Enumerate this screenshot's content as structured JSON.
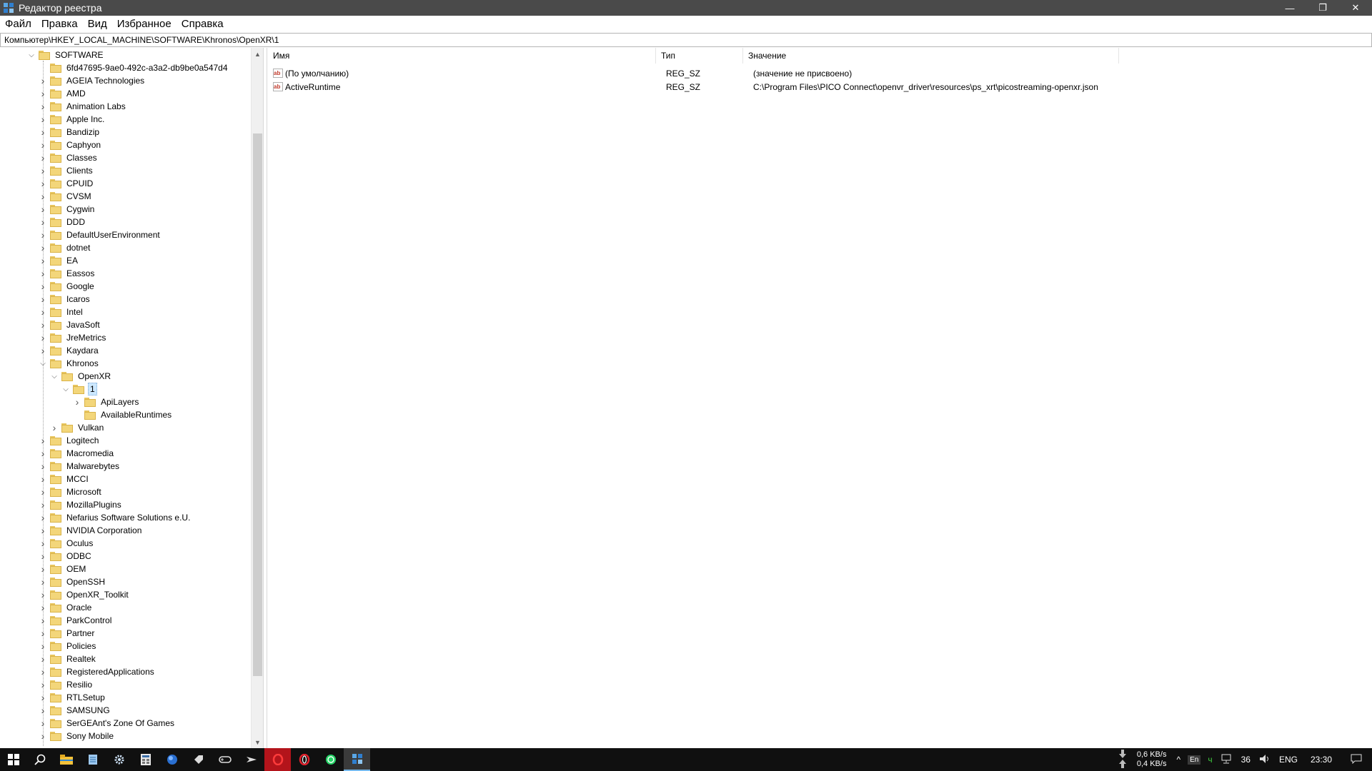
{
  "window": {
    "title": "Редактор реестра",
    "minimize_glyph": "—",
    "maximize_glyph": "❐",
    "close_glyph": "✕"
  },
  "menu": {
    "items": [
      "Файл",
      "Правка",
      "Вид",
      "Избранное",
      "Справка"
    ]
  },
  "address": {
    "path": "Компьютер\\HKEY_LOCAL_MACHINE\\SOFTWARE\\Khronos\\OpenXR\\1"
  },
  "tree": {
    "rows": [
      {
        "label": "SOFTWARE",
        "depth": 0,
        "expander": "expanded"
      },
      {
        "label": "6fd47695-9ae0-492c-a3a2-db9be0a547d4",
        "depth": 1,
        "expander": "none"
      },
      {
        "label": "AGEIA Technologies",
        "depth": 1,
        "expander": "collapsed"
      },
      {
        "label": "AMD",
        "depth": 1,
        "expander": "collapsed"
      },
      {
        "label": "Animation Labs",
        "depth": 1,
        "expander": "collapsed"
      },
      {
        "label": "Apple Inc.",
        "depth": 1,
        "expander": "collapsed"
      },
      {
        "label": "Bandizip",
        "depth": 1,
        "expander": "collapsed"
      },
      {
        "label": "Caphyon",
        "depth": 1,
        "expander": "collapsed"
      },
      {
        "label": "Classes",
        "depth": 1,
        "expander": "collapsed"
      },
      {
        "label": "Clients",
        "depth": 1,
        "expander": "collapsed"
      },
      {
        "label": "CPUID",
        "depth": 1,
        "expander": "collapsed"
      },
      {
        "label": "CVSM",
        "depth": 1,
        "expander": "collapsed"
      },
      {
        "label": "Cygwin",
        "depth": 1,
        "expander": "collapsed"
      },
      {
        "label": "DDD",
        "depth": 1,
        "expander": "collapsed"
      },
      {
        "label": "DefaultUserEnvironment",
        "depth": 1,
        "expander": "collapsed"
      },
      {
        "label": "dotnet",
        "depth": 1,
        "expander": "collapsed"
      },
      {
        "label": "EA",
        "depth": 1,
        "expander": "collapsed"
      },
      {
        "label": "Eassos",
        "depth": 1,
        "expander": "collapsed"
      },
      {
        "label": "Google",
        "depth": 1,
        "expander": "collapsed"
      },
      {
        "label": "Icaros",
        "depth": 1,
        "expander": "collapsed"
      },
      {
        "label": "Intel",
        "depth": 1,
        "expander": "collapsed"
      },
      {
        "label": "JavaSoft",
        "depth": 1,
        "expander": "collapsed"
      },
      {
        "label": "JreMetrics",
        "depth": 1,
        "expander": "collapsed"
      },
      {
        "label": "Kaydara",
        "depth": 1,
        "expander": "collapsed"
      },
      {
        "label": "Khronos",
        "depth": 1,
        "expander": "expanded"
      },
      {
        "label": "OpenXR",
        "depth": 2,
        "expander": "expanded"
      },
      {
        "label": "1",
        "depth": 3,
        "expander": "expanded",
        "selected": true
      },
      {
        "label": "ApiLayers",
        "depth": 4,
        "expander": "collapsed"
      },
      {
        "label": "AvailableRuntimes",
        "depth": 4,
        "expander": "none"
      },
      {
        "label": "Vulkan",
        "depth": 2,
        "expander": "collapsed"
      },
      {
        "label": "Logitech",
        "depth": 1,
        "expander": "collapsed"
      },
      {
        "label": "Macromedia",
        "depth": 1,
        "expander": "collapsed"
      },
      {
        "label": "Malwarebytes",
        "depth": 1,
        "expander": "collapsed"
      },
      {
        "label": "MCCI",
        "depth": 1,
        "expander": "collapsed"
      },
      {
        "label": "Microsoft",
        "depth": 1,
        "expander": "collapsed"
      },
      {
        "label": "MozillaPlugins",
        "depth": 1,
        "expander": "collapsed"
      },
      {
        "label": "Nefarius Software Solutions e.U.",
        "depth": 1,
        "expander": "collapsed"
      },
      {
        "label": "NVIDIA Corporation",
        "depth": 1,
        "expander": "collapsed"
      },
      {
        "label": "Oculus",
        "depth": 1,
        "expander": "collapsed"
      },
      {
        "label": "ODBC",
        "depth": 1,
        "expander": "collapsed"
      },
      {
        "label": "OEM",
        "depth": 1,
        "expander": "collapsed"
      },
      {
        "label": "OpenSSH",
        "depth": 1,
        "expander": "collapsed"
      },
      {
        "label": "OpenXR_Toolkit",
        "depth": 1,
        "expander": "collapsed"
      },
      {
        "label": "Oracle",
        "depth": 1,
        "expander": "collapsed"
      },
      {
        "label": "ParkControl",
        "depth": 1,
        "expander": "collapsed"
      },
      {
        "label": "Partner",
        "depth": 1,
        "expander": "collapsed"
      },
      {
        "label": "Policies",
        "depth": 1,
        "expander": "collapsed"
      },
      {
        "label": "Realtek",
        "depth": 1,
        "expander": "collapsed"
      },
      {
        "label": "RegisteredApplications",
        "depth": 1,
        "expander": "collapsed"
      },
      {
        "label": "Resilio",
        "depth": 1,
        "expander": "collapsed"
      },
      {
        "label": "RTLSetup",
        "depth": 1,
        "expander": "collapsed"
      },
      {
        "label": "SAMSUNG",
        "depth": 1,
        "expander": "collapsed"
      },
      {
        "label": "SerGEAnt's Zone Of Games",
        "depth": 1,
        "expander": "collapsed"
      },
      {
        "label": "Sony Mobile",
        "depth": 1,
        "expander": "collapsed"
      }
    ]
  },
  "values": {
    "columns": {
      "name": "Имя",
      "type": "Тип",
      "data": "Значение"
    },
    "rows": [
      {
        "name": "(По умолчанию)",
        "type": "REG_SZ",
        "data": "(значение не присвоено)"
      },
      {
        "name": "ActiveRuntime",
        "type": "REG_SZ",
        "data": "C:\\Program Files\\PICO Connect\\openvr_driver\\resources\\ps_xrt\\picostreaming-openxr.json"
      }
    ],
    "icon_text": "ab"
  },
  "taskbar": {
    "speed_down": "0,6 KB/s",
    "speed_up": "0,4 KB/s",
    "lang_badge": "En",
    "battery": "36",
    "lang": "ENG",
    "time": "23:30"
  },
  "colors": {
    "titlebar": "#4a4a4a",
    "folder": "#f3d67a",
    "selection": "#cce8ff",
    "taskbar": "#101010"
  }
}
